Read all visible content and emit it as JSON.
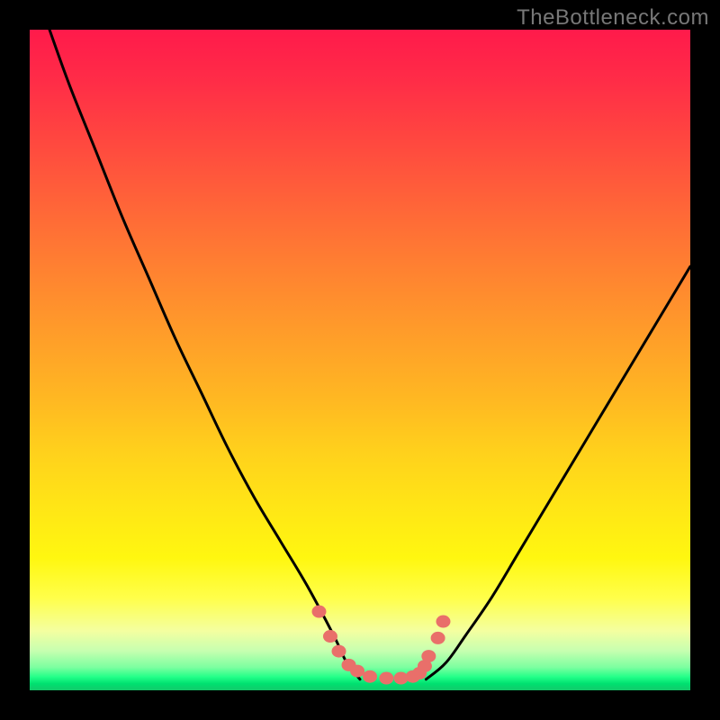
{
  "watermark": "TheBottleneck.com",
  "colors": {
    "background": "#000000",
    "gradient_top": "#ff1a4b",
    "gradient_bottom": "#13c96a",
    "curve": "#000000",
    "dot": "#e96f6a"
  },
  "chart_data": {
    "type": "line",
    "title": "",
    "xlabel": "",
    "ylabel": "",
    "xlim": [
      0,
      100
    ],
    "ylim": [
      0,
      120
    ],
    "series": [
      {
        "name": "left-curve",
        "x": [
          3,
          6,
          10,
          14,
          18,
          22,
          26,
          30,
          34,
          38,
          42,
          46,
          48,
          50
        ],
        "y": [
          120,
          110,
          98,
          86,
          75,
          64,
          54,
          44,
          35,
          27,
          19,
          10,
          5,
          2
        ]
      },
      {
        "name": "right-curve",
        "x": [
          60,
          63,
          66,
          70,
          74,
          78,
          82,
          86,
          90,
          94,
          98,
          100
        ],
        "y": [
          2,
          5,
          10,
          17,
          25,
          33,
          41,
          49,
          57,
          65,
          73,
          77
        ]
      },
      {
        "name": "dots",
        "x": [
          43.8,
          45.5,
          46.8,
          48.3,
          49.6,
          51.5,
          54.0,
          56.2,
          58.0,
          59.0,
          59.8,
          60.4,
          61.8,
          62.6
        ],
        "y": [
          14.3,
          9.8,
          7.1,
          4.6,
          3.5,
          2.5,
          2.2,
          2.2,
          2.5,
          3.1,
          4.4,
          6.2,
          9.5,
          12.5
        ]
      }
    ]
  }
}
